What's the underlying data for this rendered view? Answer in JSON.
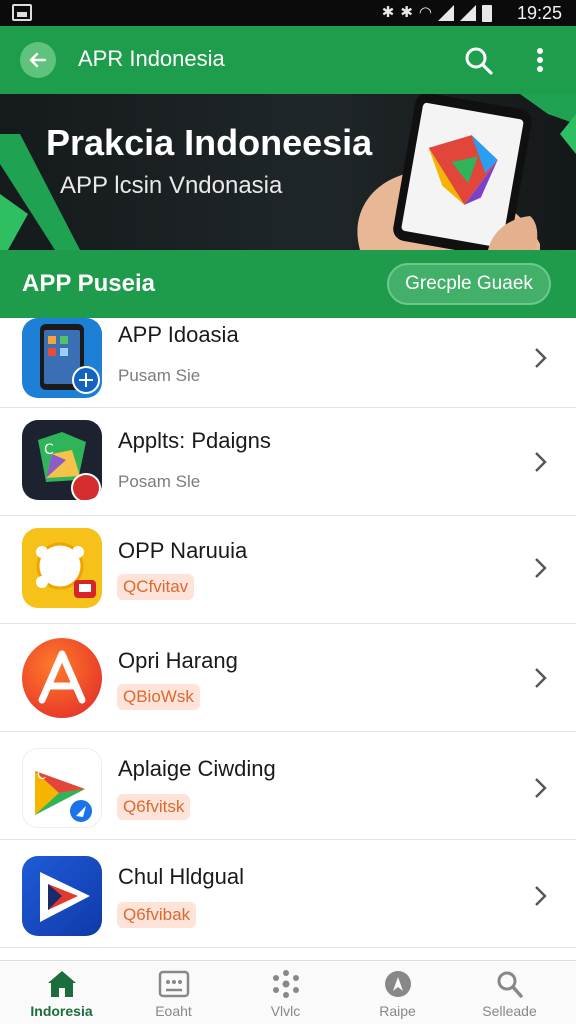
{
  "status_bar": {
    "time": "19:25"
  },
  "app_bar": {
    "title": "APR Indonesia"
  },
  "banner": {
    "title": "Prakcia Indoneesia",
    "subtitle": "APP lcsin Vndonasia"
  },
  "section": {
    "title": "APP Puseia",
    "action_label": "Grecple Guaek"
  },
  "apps": [
    {
      "title": "APP Idoasia",
      "subtitle": "Pusam Sie"
    },
    {
      "title": "Applts: Pdaigns",
      "subtitle": "Posam Sle"
    },
    {
      "title": "OPP Naruuia",
      "tag": "QCfvitav"
    },
    {
      "title": "Opri Harang",
      "tag": "QBioWsk"
    },
    {
      "title": "Aplaige Ciwding",
      "tag": "Q6fvitsk"
    },
    {
      "title": "Chul Hldgual",
      "tag": "Q6fvibak"
    }
  ],
  "bottom_nav": [
    {
      "label": "Indoresia",
      "icon": "home-icon",
      "active": true
    },
    {
      "label": "Eoaht",
      "icon": "dashboard-icon"
    },
    {
      "label": "Vlvlc",
      "icon": "dots-icon"
    },
    {
      "label": "Raipe",
      "icon": "compass-icon"
    },
    {
      "label": "Selleade",
      "icon": "search-icon"
    }
  ],
  "colors": {
    "primary": "#1e9e4c",
    "banner_bg": "#1c2225",
    "tag_bg": "#fde3d8",
    "tag_text": "#d96a35"
  }
}
